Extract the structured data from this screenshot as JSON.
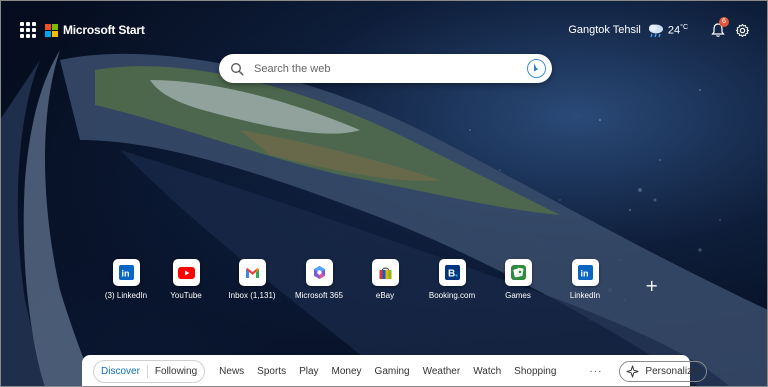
{
  "header": {
    "brand": "Microsoft Start",
    "location": "Gangtok Tehsil",
    "temperature": "24",
    "temperature_unit": "°C",
    "notification_count": "6",
    "weather_icon": "cloud-rain-icon"
  },
  "search": {
    "placeholder": "Search the web"
  },
  "quick_links": [
    {
      "label": "(3) LinkedIn",
      "icon": "linkedin-icon"
    },
    {
      "label": "YouTube",
      "icon": "youtube-icon"
    },
    {
      "label": "Inbox (1,131)",
      "icon": "gmail-icon"
    },
    {
      "label": "Microsoft 365",
      "icon": "microsoft-365-icon"
    },
    {
      "label": "eBay",
      "icon": "ebay-icon"
    },
    {
      "label": "Booking.com",
      "icon": "booking-icon"
    },
    {
      "label": "Games",
      "icon": "games-icon"
    },
    {
      "label": "LinkedIn",
      "icon": "linkedin-icon"
    }
  ],
  "add_shortcut": "+",
  "feed_nav": {
    "discover": "Discover",
    "following": "Following",
    "categories": [
      "News",
      "Sports",
      "Play",
      "Money",
      "Gaming",
      "Weather",
      "Watch",
      "Shopping"
    ],
    "more": "···",
    "personalize": "Personalize"
  },
  "colors": {
    "accent": "#0f6cbd",
    "ms_red": "#f25022",
    "ms_green": "#7fba00",
    "ms_blue": "#00a4ef",
    "ms_yellow": "#ffb900",
    "linkedin": "#0a66c2",
    "youtube": "#ff0000",
    "badge": "#e0563a"
  }
}
